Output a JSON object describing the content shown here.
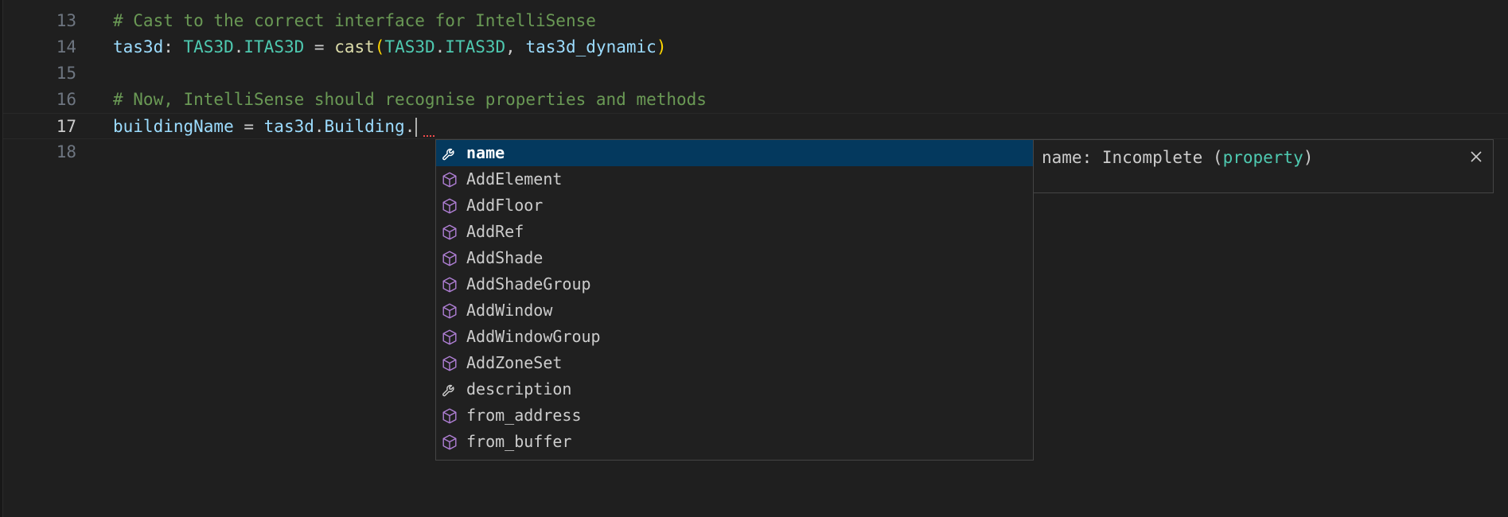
{
  "editor": {
    "lines": [
      {
        "number": "13",
        "tokens": [
          {
            "text": "# Cast to the correct interface for IntelliSense",
            "kind": "comment"
          }
        ]
      },
      {
        "number": "14",
        "tokens": [
          {
            "text": "tas3d",
            "kind": "var"
          },
          {
            "text": ": ",
            "kind": "plain"
          },
          {
            "text": "TAS3D",
            "kind": "type"
          },
          {
            "text": ".",
            "kind": "plain"
          },
          {
            "text": "ITAS3D",
            "kind": "type"
          },
          {
            "text": " = ",
            "kind": "plain"
          },
          {
            "text": "cast",
            "kind": "fn"
          },
          {
            "text": "(",
            "kind": "paren"
          },
          {
            "text": "TAS3D",
            "kind": "type"
          },
          {
            "text": ".",
            "kind": "plain"
          },
          {
            "text": "ITAS3D",
            "kind": "type"
          },
          {
            "text": ", ",
            "kind": "plain"
          },
          {
            "text": "tas3d_dynamic",
            "kind": "var"
          },
          {
            "text": ")",
            "kind": "paren"
          }
        ]
      },
      {
        "number": "15",
        "tokens": []
      },
      {
        "number": "16",
        "tokens": [
          {
            "text": "# Now, IntelliSense should recognise properties and methods",
            "kind": "comment"
          }
        ]
      },
      {
        "number": "17",
        "tokens": [
          {
            "text": "buildingName",
            "kind": "var"
          },
          {
            "text": " = ",
            "kind": "plain"
          },
          {
            "text": "tas3d",
            "kind": "var"
          },
          {
            "text": ".",
            "kind": "plain"
          },
          {
            "text": "Building",
            "kind": "var"
          },
          {
            "text": ".",
            "kind": "plain"
          }
        ]
      },
      {
        "number": "18",
        "tokens": []
      }
    ]
  },
  "suggestions": {
    "selected_index": 0,
    "items": [
      {
        "label": "name",
        "icon": "wrench-icon"
      },
      {
        "label": "AddElement",
        "icon": "cube-icon"
      },
      {
        "label": "AddFloor",
        "icon": "cube-icon"
      },
      {
        "label": "AddRef",
        "icon": "cube-icon"
      },
      {
        "label": "AddShade",
        "icon": "cube-icon"
      },
      {
        "label": "AddShadeGroup",
        "icon": "cube-icon"
      },
      {
        "label": "AddWindow",
        "icon": "cube-icon"
      },
      {
        "label": "AddWindowGroup",
        "icon": "cube-icon"
      },
      {
        "label": "AddZoneSet",
        "icon": "cube-icon"
      },
      {
        "label": "description",
        "icon": "wrench-icon"
      },
      {
        "label": "from_address",
        "icon": "cube-icon"
      },
      {
        "label": "from_buffer",
        "icon": "cube-icon"
      }
    ]
  },
  "details": {
    "signature": "name: Incomplete (",
    "kind": "property",
    "suffix": ")",
    "close_icon": "close-icon"
  },
  "colors": {
    "background": "#1f1f1f",
    "comment": "#6a9955",
    "variable": "#9cdcfe",
    "type": "#4ec9b0",
    "function": "#dcdcaa",
    "bracket": "#ffd700",
    "selection": "#04395e",
    "method_icon": "#b180d7"
  }
}
